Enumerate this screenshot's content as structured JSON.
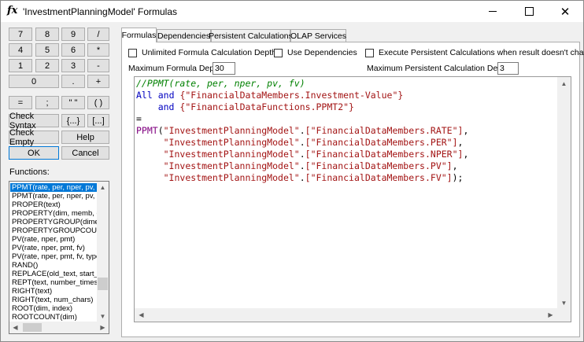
{
  "window": {
    "title_icon": "fx",
    "title": "'InvestmentPlanningModel' Formulas",
    "minimize_icon": "minimize-icon",
    "maximize_icon": "maximize-icon",
    "close_icon": "close-icon",
    "close_glyph": "✕"
  },
  "keypad": {
    "row1": [
      "7",
      "8",
      "9",
      "/"
    ],
    "row2": [
      "4",
      "5",
      "6",
      "*"
    ],
    "row3": [
      "1",
      "2",
      "3",
      "-"
    ],
    "row4": [
      "0",
      ".",
      "+"
    ],
    "row5": [
      "=",
      ";",
      "\" \"",
      "( )"
    ],
    "check_syntax": "Check Syntax",
    "braces": "{...}",
    "brackets": "[...]",
    "check_empty": "Check Empty",
    "help": "Help",
    "ok": "OK",
    "cancel": "Cancel"
  },
  "functions": {
    "label": "Functions:",
    "items": [
      "PPMT(rate, per, nper, pv, fv)",
      "PPMT(rate, per, nper, pv, fv, type)",
      "PROPER(text)",
      "PROPERTY(dim, memb, group)",
      "PROPERTYGROUP(dimension)",
      "PROPERTYGROUPCOUNT",
      "PV(rate, nper, pmt)",
      "PV(rate, nper, pmt, fv)",
      "PV(rate, nper, pmt, fv, type)",
      "RAND()",
      "REPLACE(old_text, start_num)",
      "REPT(text, number_times)",
      "RIGHT(text)",
      "RIGHT(text, num_chars)",
      "ROOT(dim, index)",
      "ROOTCOUNT(dim)"
    ],
    "selected_index": 0
  },
  "tabs": [
    "Formulas",
    "Dependencies",
    "Persistent Calculations",
    "OLAP Services"
  ],
  "active_tab": 0,
  "options": {
    "unlimited_depth": "Unlimited Formula Calculation Depth",
    "use_dependencies": "Use Dependencies",
    "execute_persistent": "Execute Persistent Calculations when result doesn't change",
    "max_formula_depth_label": "Maximum Formula Depth:",
    "max_formula_depth_value": "30",
    "max_persistent_depth_label": "Maximum Persistent Calculation Depth:",
    "max_persistent_depth_value": "3"
  },
  "code": {
    "comment": "//PPMT(rate, per, nper, pv, fv)",
    "kw_all": "All",
    "kw_and": "and",
    "ref1": "{\"FinancialDataMembers.Investment-Value\"}",
    "ref2": "{\"FinancialDataFunctions.PPMT2\"}",
    "equals": "=",
    "fn": "PPMT",
    "model": "\"InvestmentPlanningModel\"",
    "args": [
      "[\"FinancialDataMembers.RATE\"]",
      "[\"FinancialDataMembers.PER\"]",
      "[\"FinancialDataMembers.NPER\"]",
      "[\"FinancialDataMembers.PV\"]",
      "[\"FinancialDataMembers.FV\"]"
    ]
  }
}
